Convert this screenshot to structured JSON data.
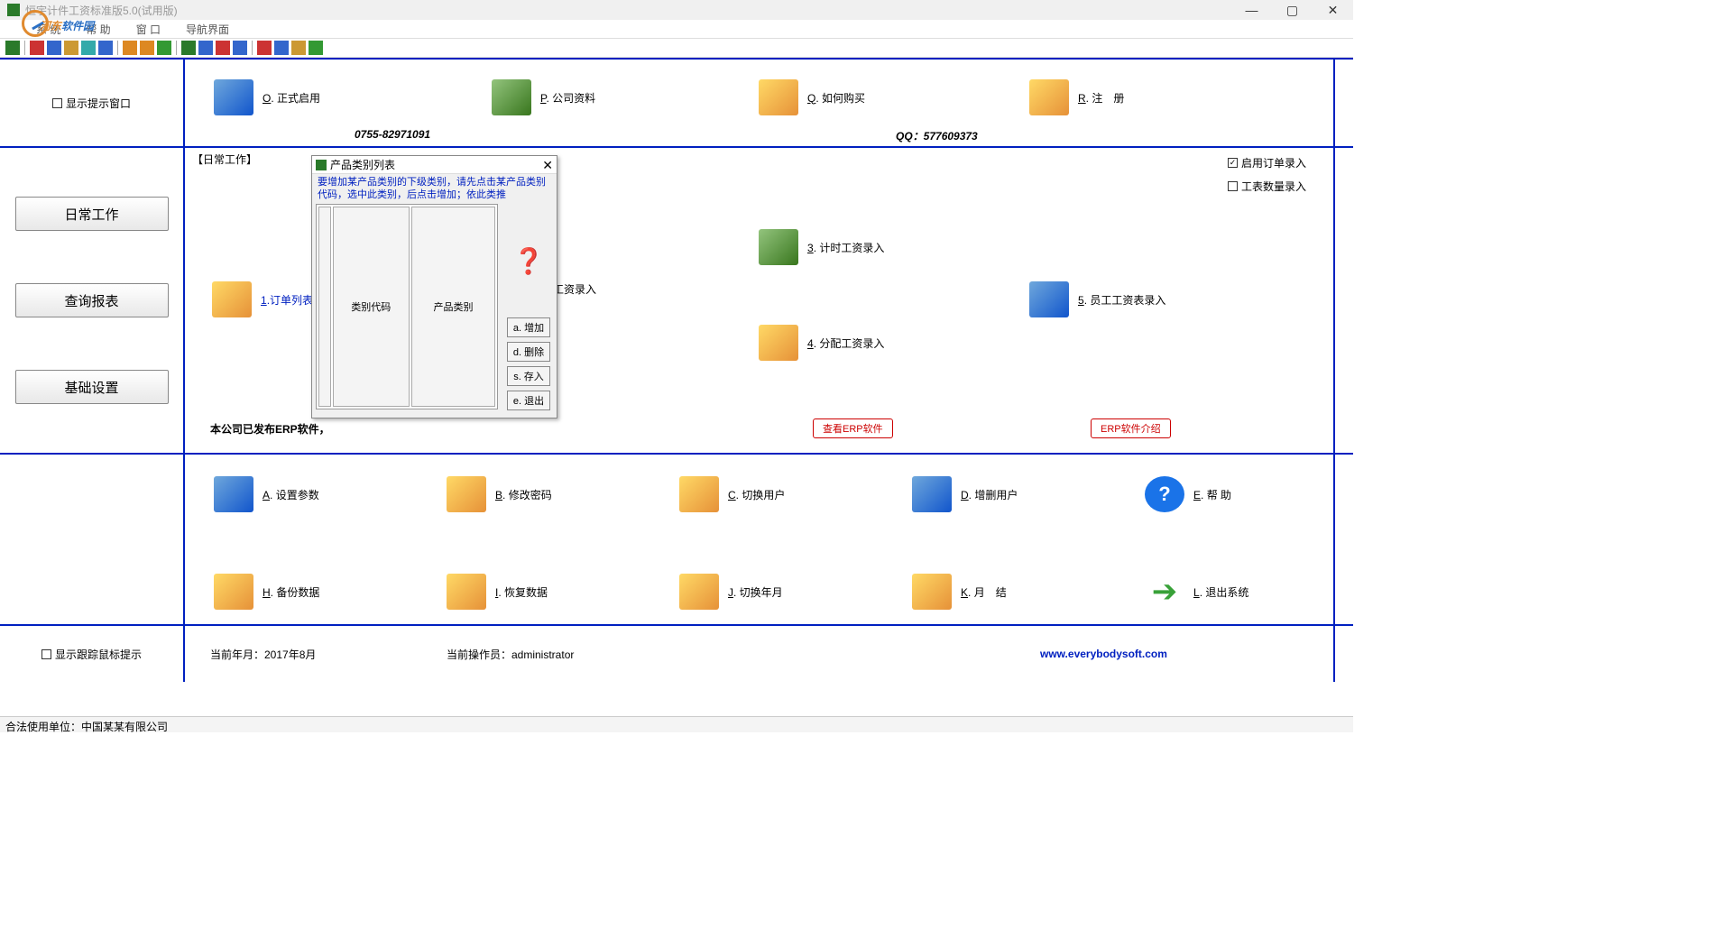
{
  "title": "恒宇计件工资标准版5.0(试用版)",
  "menu": {
    "m1": "系 统",
    "m2": "帮 助",
    "m3": "窗 口",
    "m4": "导航界面"
  },
  "watermark": {
    "text1": "河东",
    "text2": "软件园"
  },
  "topbar": {
    "o": "正式启用",
    "oKey": "O",
    "p": "公司资料",
    "pKey": "P",
    "q": "如何购买",
    "qKey": "Q",
    "r": "注　册",
    "rKey": "R",
    "phone": "0755-82971091",
    "qq": "QQ：577609373",
    "chkShow": "显示提示窗口"
  },
  "sec2": {
    "title": "【日常工作】",
    "chkOrder": "启用订单录入",
    "chkSheet": "工表数量录入",
    "btnDaily": "日常工作",
    "btnQuery": "查询报表",
    "btnBase": "基础设置",
    "i1": "订单列表",
    "i1k": "1",
    "i2": "工资录入",
    "i3": "计时工资录入",
    "i3k": "3",
    "i4": "分配工资录入",
    "i4k": "4",
    "i5": "员工工资表录入",
    "i5k": "5",
    "erpText": "本公司已发布ERP软件，",
    "erpBtn1": "查看ERP软件",
    "erpBtn2": "ERP软件介绍"
  },
  "sec3": {
    "a": "设置参数",
    "ak": "A",
    "b": "修改密码",
    "bk": "B",
    "c": "切换用户",
    "ck": "C",
    "d": "增删用户",
    "dk": "D",
    "e": "帮  助",
    "ek": "E",
    "h": "备份数据",
    "hk": "H",
    "i": "恢复数据",
    "ik": "I",
    "j": "切换年月",
    "jk": "J",
    "k": "月　结",
    "kk": "K",
    "l": "退出系统",
    "lk": "L"
  },
  "sec4": {
    "chkMouse": "显示跟踪鼠标提示",
    "ym": "当前年月：2017年8月",
    "op": "当前操作员：administrator",
    "url": "www.everybodysoft.com"
  },
  "footer": "合法使用单位：中国某某有限公司",
  "dialog": {
    "title": "产品类别列表",
    "hint": "要增加某产品类别的下级类别，请先点击某产品类别代码，选中此类别，后点击增加；依此类推",
    "col1": "类别代码",
    "col2": "产品类别",
    "add": "a. 增加",
    "del": "d. 删除",
    "save": "s. 存入",
    "exit": "e. 退出"
  }
}
